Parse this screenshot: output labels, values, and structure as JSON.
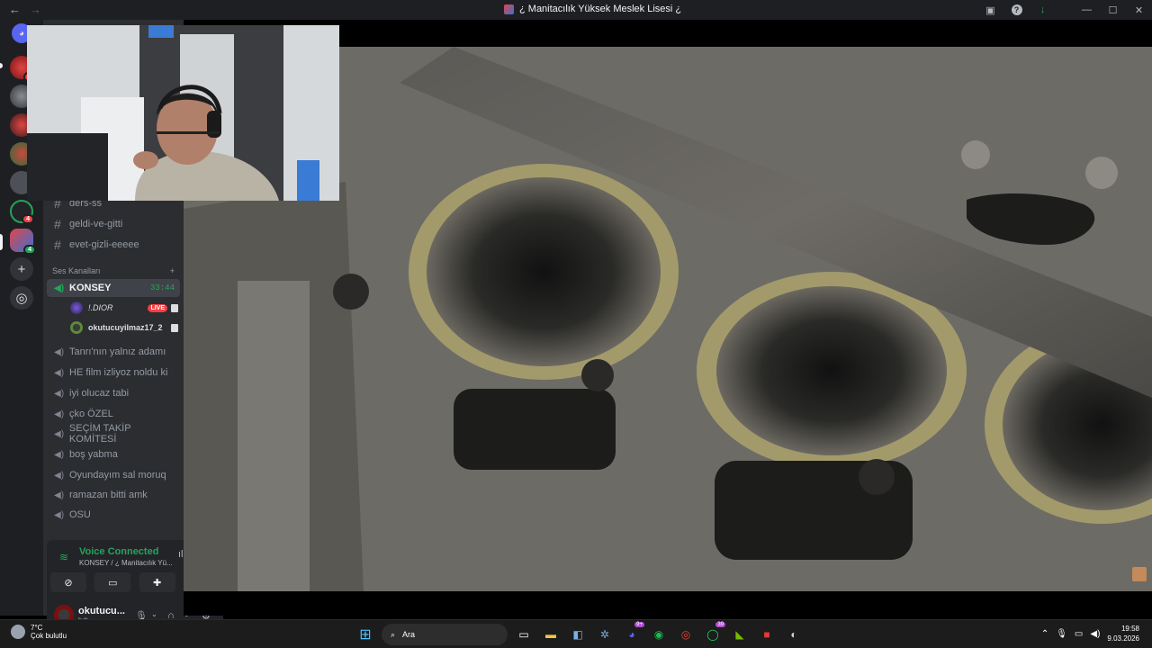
{
  "window": {
    "title": "¿ Manitacılık Yüksek Meslek Lisesi ¿",
    "nav_back": "←",
    "nav_forward": "→",
    "inbox_icon": "inbox-icon",
    "help_icon": "?",
    "download_icon": "↓",
    "minimize": "—",
    "maximize": "☐",
    "close": "✕"
  },
  "guilds": {
    "badges": [
      "4",
      "4"
    ],
    "add_label": "+",
    "discover_label": "◎"
  },
  "channels": {
    "text": [
      "ders-ss",
      "geldi-ve-gitti",
      "evet-gizli-eeeee"
    ],
    "voice_category": "Ses Kanalları",
    "voice_category_add": "+",
    "active_voice": {
      "name": "KONSEY",
      "timer": "33:44",
      "users": [
        {
          "name": "!.DIOR",
          "live": "LIVE"
        },
        {
          "name": "okutucuyilmaz17_2"
        }
      ]
    },
    "voice": [
      "Tanrı'nın yalnız adamı",
      "HE film izliyoz noldu ki",
      "iyi olucaz tabi",
      "çko ÖZEL",
      "SEÇİM TAKİP KOMİTESİ",
      "boş yabma",
      "Oyundayım sal moruq",
      "ramazan bitti amk",
      "OSU"
    ]
  },
  "voice_panel": {
    "status": "Voice Connected",
    "subtitle": "KONSEY / ¿ Manitacılık Yü...",
    "user_name": "okutucu...",
    "user_status": "brb"
  },
  "taskbar": {
    "temp": "7°C",
    "weather": "Çok bulutlu",
    "search_placeholder": "Ara",
    "time": "19:58",
    "date": "9.03.2026",
    "discord_badge": "9+",
    "whatsapp_badge": "39"
  },
  "colors": {
    "accent_green": "#23a55a",
    "live_red": "#f23f43",
    "sidebar": "#2b2d31",
    "guilds": "#1e1f22"
  }
}
